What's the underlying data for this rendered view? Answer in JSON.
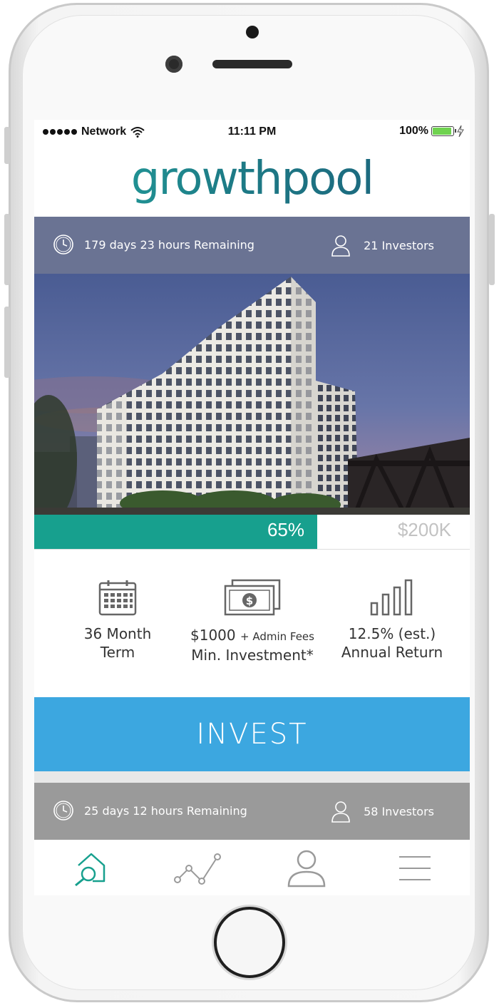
{
  "status_bar": {
    "carrier": "Network",
    "time": "11:11 PM",
    "battery": "100%",
    "battery_level": 1.0
  },
  "app": {
    "logo": "growthpool"
  },
  "listing_1": {
    "time_remaining": "179 days 23 hours Remaining",
    "investors": "21 Investors",
    "funded_percent": "65%",
    "funded_fraction": 0.65,
    "goal": "$200K",
    "term_value": "36 Month",
    "term_label": "Term",
    "min_investment_value": "$1000",
    "min_investment_fees": "+ Admin Fees",
    "min_investment_label": "Min. Investment*",
    "return_value": "12.5% (est.)",
    "return_label": "Annual Return",
    "invest_label": "INVEST"
  },
  "listing_2": {
    "time_remaining": "25 days 12 hours Remaining",
    "investors": "58 Investors"
  },
  "tab_bar": {
    "items": [
      "home-search-icon",
      "chart-icon",
      "profile-icon",
      "menu-icon"
    ],
    "active_color": "#17a08e",
    "inactive_color": "#9a9a9a"
  },
  "colors": {
    "accent": "#17a08e",
    "invest_button": "#3ca7e0",
    "header_bar": "#6a7393"
  }
}
